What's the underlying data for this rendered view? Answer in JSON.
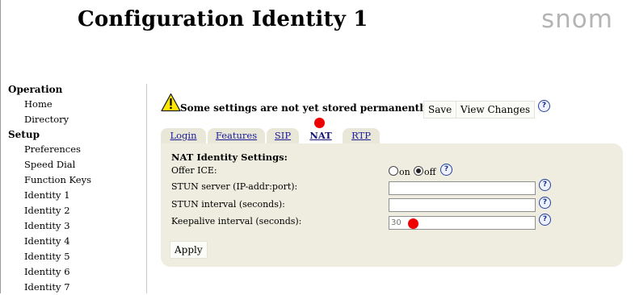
{
  "header": {
    "title": "Configuration Identity 1",
    "logo_text": "snom"
  },
  "sidebar": {
    "sections": [
      {
        "label": "Operation",
        "items": [
          "Home",
          "Directory"
        ]
      },
      {
        "label": "Setup",
        "items": [
          "Preferences",
          "Speed Dial",
          "Function Keys",
          "Identity 1",
          "Identity 2",
          "Identity 3",
          "Identity 4",
          "Identity 5",
          "Identity 6",
          "Identity 7"
        ]
      }
    ]
  },
  "notice": {
    "message": "Some settings are not yet stored permanently.",
    "save_label": "Save",
    "view_changes_label": "View Changes",
    "help_glyph": "?"
  },
  "tabs": [
    {
      "label": "Login",
      "active": false
    },
    {
      "label": "Features",
      "active": false
    },
    {
      "label": "SIP",
      "active": false
    },
    {
      "label": "NAT",
      "active": true
    },
    {
      "label": "RTP",
      "active": false
    }
  ],
  "nat": {
    "heading": "NAT Identity Settings:",
    "offer_ice": {
      "label": "Offer ICE:",
      "on_label": "on",
      "off_label": "off",
      "selected": "off"
    },
    "stun_server": {
      "label": "STUN server (IP-addr:port):",
      "value": ""
    },
    "stun_interval": {
      "label": "STUN interval (seconds):",
      "value": ""
    },
    "keepalive_interval": {
      "label": "Keepalive interval (seconds):",
      "value": "30"
    },
    "apply_label": "Apply"
  },
  "colors": {
    "panel_bg": "#eeede0",
    "tab_bg": "#e9e7d7",
    "marker": "#ee0000",
    "logo": "#b4b4b4"
  },
  "icons": {
    "warning": "warning-triangle-icon",
    "help": "help-icon"
  }
}
